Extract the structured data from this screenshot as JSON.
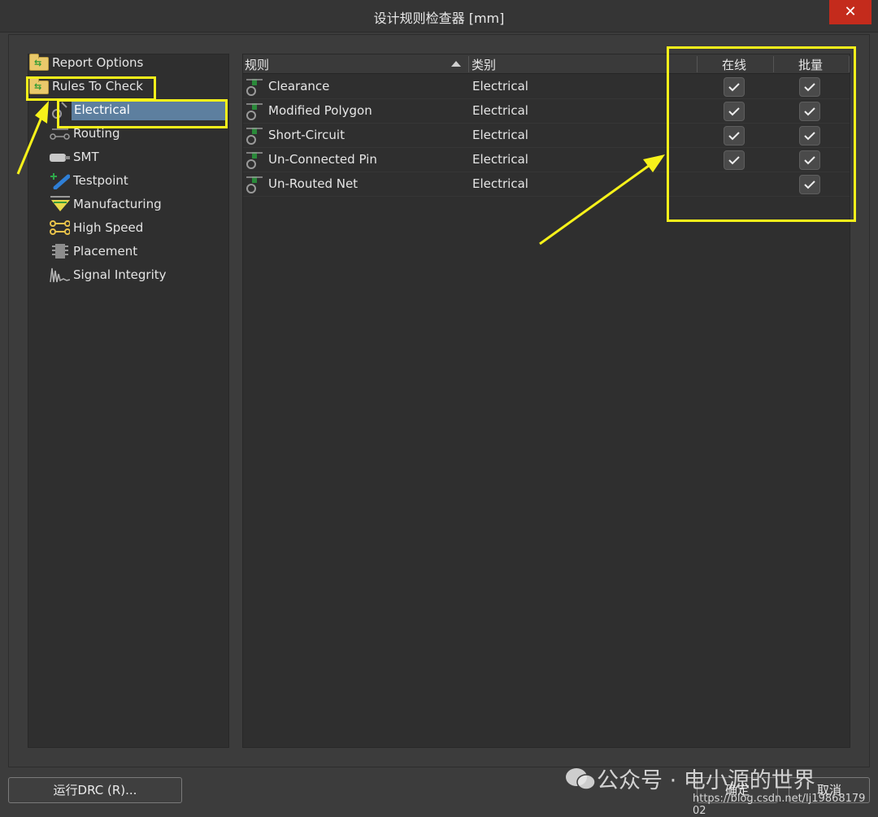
{
  "window": {
    "title": "设计规则检查器 [mm]",
    "close_glyph": "✕"
  },
  "tree": {
    "items": [
      {
        "label": "Report Options",
        "icon": "folder-icon"
      },
      {
        "label": "Rules To Check",
        "icon": "folder-icon"
      },
      {
        "label": "Electrical",
        "icon": "electrical-icon",
        "selected": true
      },
      {
        "label": "Routing",
        "icon": "routing-icon"
      },
      {
        "label": "SMT",
        "icon": "smt-icon"
      },
      {
        "label": "Testpoint",
        "icon": "testpoint-icon"
      },
      {
        "label": "Manufacturing",
        "icon": "manufacturing-icon"
      },
      {
        "label": "High Speed",
        "icon": "high-speed-icon"
      },
      {
        "label": "Placement",
        "icon": "placement-icon"
      },
      {
        "label": "Signal Integrity",
        "icon": "signal-integrity-icon"
      }
    ]
  },
  "table": {
    "headers": {
      "rule": "规则",
      "category": "类别",
      "online": "在线",
      "batch": "批量"
    },
    "rows": [
      {
        "rule": "Clearance",
        "category": "Electrical",
        "online": true,
        "batch": true
      },
      {
        "rule": "Modified Polygon",
        "category": "Electrical",
        "online": true,
        "batch": true
      },
      {
        "rule": "Short-Circuit",
        "category": "Electrical",
        "online": true,
        "batch": true
      },
      {
        "rule": "Un-Connected Pin",
        "category": "Electrical",
        "online": true,
        "batch": true
      },
      {
        "rule": "Un-Routed Net",
        "category": "Electrical",
        "online": false,
        "batch": true
      }
    ]
  },
  "footer": {
    "run_drc": "运行DRC (R)...",
    "ok": "确定",
    "cancel": "取消"
  },
  "watermark": {
    "text": "公众号 · 电小源的世界",
    "url": "https://blog.csdn.net/lj19868179​02"
  },
  "colors": {
    "highlight": "#f7f21a",
    "selection": "#5d7f9f",
    "close": "#c42b1c"
  }
}
